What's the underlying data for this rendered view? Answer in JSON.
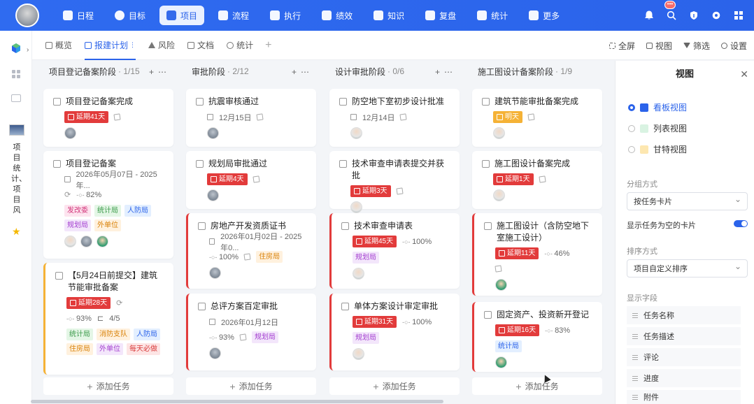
{
  "topnav": {
    "items": [
      {
        "label": "日程",
        "icon": "calendar-icon",
        "active": false
      },
      {
        "label": "目标",
        "icon": "target-icon",
        "active": false
      },
      {
        "label": "项目",
        "icon": "cube-icon",
        "active": true
      },
      {
        "label": "流程",
        "icon": "flow-icon",
        "active": false
      },
      {
        "label": "执行",
        "icon": "execute-icon",
        "active": false
      },
      {
        "label": "绩效",
        "icon": "performance-icon",
        "active": false
      },
      {
        "label": "知识",
        "icon": "book-icon",
        "active": false
      },
      {
        "label": "复盘",
        "icon": "review-icon",
        "active": false
      },
      {
        "label": "统计",
        "icon": "chart-icon",
        "active": false
      },
      {
        "label": "更多",
        "icon": "grid-icon",
        "active": false
      }
    ],
    "notification_badge": "•••"
  },
  "sidebar": {
    "project_name": "项目统计、项目风"
  },
  "tabs": [
    {
      "label": "概览",
      "active": false
    },
    {
      "label": "报建计划",
      "active": true
    },
    {
      "label": "风险",
      "active": false
    },
    {
      "label": "文档",
      "active": false
    },
    {
      "label": "统计",
      "active": false
    }
  ],
  "toolbar": {
    "fullscreen": "全屏",
    "view": "视图",
    "filter": "筛选",
    "settings": "设置"
  },
  "columns": [
    {
      "title": "项目登记备案阶段",
      "count": "· 1/15",
      "cards": [
        {
          "title": "项目登记备案完成",
          "late": "延期41天"
        },
        {
          "title": "项目登记备案",
          "date": "2026年05月07日 - 2025年...",
          "progress": "82%",
          "labels": [
            "发改委",
            "统计局",
            "人防局",
            "规划局",
            "外单位"
          ]
        },
        {
          "title": "【5月24日前提交】建筑节能审批备案",
          "late": "延期28天",
          "sub": "4/5",
          "progress": "93%",
          "labels": [
            "统计局",
            "消防支队",
            "人防局",
            "住房局",
            "外单位",
            "每天必做"
          ]
        }
      ],
      "add": "添加任务"
    },
    {
      "title": "审批阶段",
      "count": "· 2/12",
      "cards": [
        {
          "title": "抗震审核通过",
          "date": "12月15日"
        },
        {
          "title": "规划局审批通过",
          "late": "延期4天"
        },
        {
          "title": "房地产开发资质证书",
          "date": "2026年01月02日 - 2025年0...",
          "progress": "100%",
          "labels": [
            "住房局"
          ]
        },
        {
          "title": "总评方案百定审批",
          "date": "2026年01月12日",
          "progress": "93%",
          "labels": [
            "规划局"
          ]
        }
      ],
      "add": "添加任务"
    },
    {
      "title": "设计审批阶段",
      "count": "· 0/6",
      "cards": [
        {
          "title": "防空地下室初步设计批准",
          "date": "12月14日"
        },
        {
          "title": "技术审查申请表提交并获批",
          "late": "延期3天"
        },
        {
          "title": "技术审查申请表",
          "late": "延期45天",
          "progress": "100%",
          "labels": [
            "规划局"
          ]
        },
        {
          "title": "单体方案设计审定审批",
          "late": "延期31天",
          "progress": "100%",
          "labels": [
            "规划局"
          ]
        }
      ],
      "add": "添加任务"
    },
    {
      "title": "施工图设计备案阶段",
      "count": "· 1/9",
      "cards": [
        {
          "title": "建筑节能审批备案完成",
          "today": "明天"
        },
        {
          "title": "施工图设计备案完成",
          "late": "延期1天"
        },
        {
          "title": "施工图设计（含防空地下室施工设计）",
          "late": "延期11天",
          "progress": "46%"
        },
        {
          "title": "固定资产、投资新开登记",
          "late": "延期16天",
          "progress": "83%",
          "labels": [
            "统计局"
          ]
        }
      ],
      "add": "添加任务"
    }
  ],
  "panel": {
    "title": "视图",
    "views": [
      {
        "label": "看板视图",
        "selected": true,
        "icon": "kanban-icon"
      },
      {
        "label": "列表视图",
        "selected": false,
        "icon": "list-icon"
      },
      {
        "label": "甘特视图",
        "selected": false,
        "icon": "gantt-icon"
      }
    ],
    "group_label": "分组方式",
    "group_value": "按任务卡片",
    "show_empty": "显示任务为空的卡片",
    "sort_label": "排序方式",
    "sort_value": "项目自定义排序",
    "fields_label": "显示字段",
    "fields": [
      "任务名称",
      "任务描述",
      "评论",
      "进度",
      "附件"
    ]
  },
  "colors": {
    "primary": "#2b63ea",
    "late": "#e23b3b",
    "today": "#f5b236"
  }
}
